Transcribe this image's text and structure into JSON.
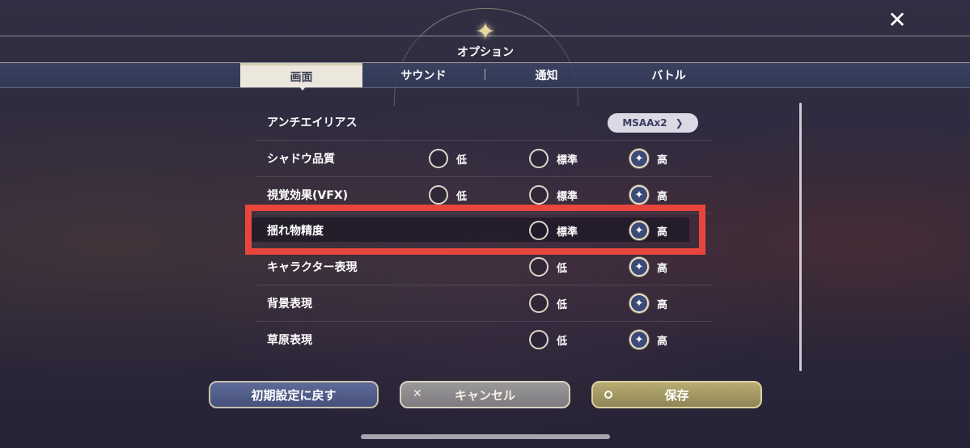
{
  "header": {
    "title": "オプション",
    "close_label": "✕"
  },
  "tabs": [
    {
      "label": "画面",
      "active": true
    },
    {
      "label": "サウンド",
      "active": false
    },
    {
      "label": "通知",
      "active": false
    },
    {
      "label": "バトル",
      "active": false
    }
  ],
  "settings": {
    "antialias": {
      "label": "アンチエイリアス",
      "value": "MSAAx2"
    },
    "rows": [
      {
        "label": "シャドウ品質",
        "options": [
          "低",
          "標準",
          "高"
        ],
        "selected": "高"
      },
      {
        "label": "視覚効果(VFX)",
        "options": [
          "低",
          "標準",
          "高"
        ],
        "selected": "高"
      },
      {
        "label": "揺れ物精度",
        "options": [
          "標準",
          "高"
        ],
        "selected": "高"
      },
      {
        "label": "キャラクター表現",
        "options": [
          "低",
          "高"
        ],
        "selected": "高"
      },
      {
        "label": "背景表現",
        "options": [
          "低",
          "高"
        ],
        "selected": "高"
      },
      {
        "label": "草原表現",
        "options": [
          "低",
          "高"
        ],
        "selected": "高"
      }
    ]
  },
  "buttons": {
    "reset": "初期設定に戻す",
    "cancel": "キャンセル",
    "save": "保存"
  },
  "colors": {
    "highlight": "#e8463c",
    "accent": "#3c4a78",
    "save": "#b9ad74"
  }
}
